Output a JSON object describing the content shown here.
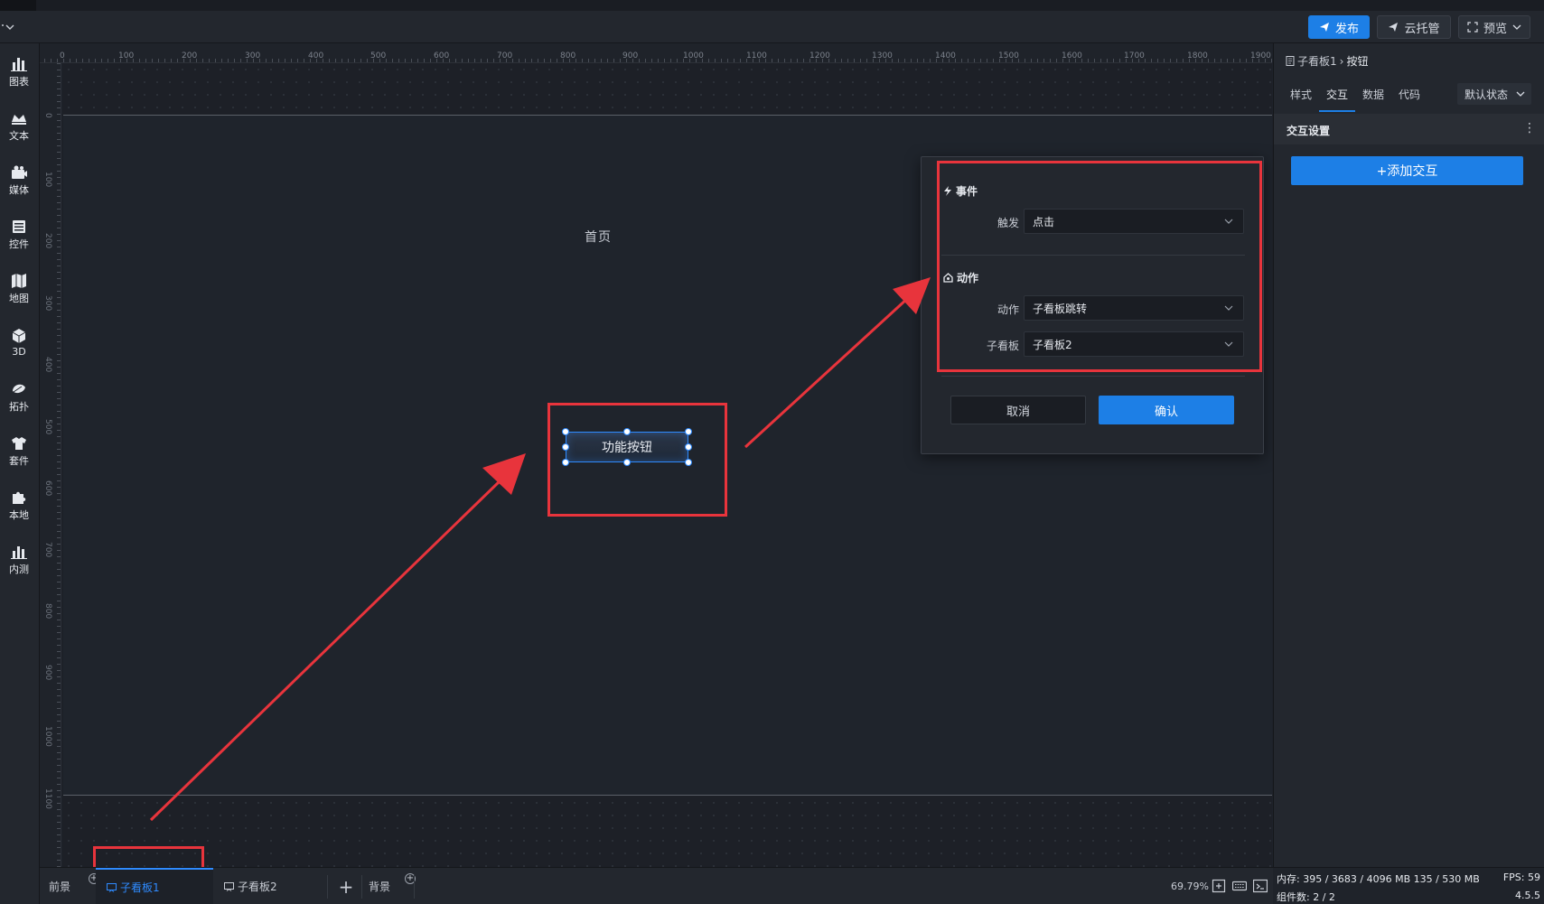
{
  "topbar": {
    "publish": "发布",
    "cloud_host": "云托管",
    "preview": "预览"
  },
  "sidebar": {
    "items": [
      {
        "label": "图表",
        "icon": "bar-chart-icon"
      },
      {
        "label": "文本",
        "icon": "text-icon"
      },
      {
        "label": "媒体",
        "icon": "camera-icon"
      },
      {
        "label": "控件",
        "icon": "widget-icon"
      },
      {
        "label": "地图",
        "icon": "map-icon"
      },
      {
        "label": "3D",
        "icon": "cube-icon"
      },
      {
        "label": "拓扑",
        "icon": "topology-icon"
      },
      {
        "label": "套件",
        "icon": "suite-icon"
      },
      {
        "label": "本地",
        "icon": "puzzle-icon"
      },
      {
        "label": "内测",
        "icon": "beta-icon"
      }
    ]
  },
  "ruler": {
    "top": [
      "0",
      "100",
      "200",
      "300",
      "400",
      "500",
      "600",
      "700",
      "800",
      "900",
      "1000",
      "1100",
      "1200",
      "1300",
      "1400",
      "1500",
      "1600",
      "1700",
      "1800",
      "1900"
    ],
    "left": [
      "0",
      "100",
      "200",
      "300",
      "400",
      "500",
      "600",
      "700",
      "800",
      "900",
      "1000",
      "1100"
    ]
  },
  "canvas": {
    "home_label": "首页",
    "function_button": "功能按钮"
  },
  "popup": {
    "event_title": "事件",
    "trigger_label": "触发",
    "trigger_value": "点击",
    "action_title": "动作",
    "action_label": "动作",
    "action_value": "子看板跳转",
    "board_label": "子看板",
    "board_value": "子看板2",
    "cancel": "取消",
    "confirm": "确认"
  },
  "right_panel": {
    "breadcrumb_parent": "子看板1",
    "breadcrumb_current": "按钮",
    "tabs": [
      "样式",
      "交互",
      "数据",
      "代码"
    ],
    "active_tab": "交互",
    "state_select": "默认状态",
    "section_title": "交互设置",
    "add_button": "+添加交互"
  },
  "bottom": {
    "tabs": [
      "前景",
      "子看板1",
      "子看板2",
      "背景"
    ],
    "add_symbol": "+",
    "zoom": "69.79%"
  },
  "status": {
    "memory": "内存: 395 / 3683 / 4096 MB  135 / 530 MB",
    "components": "组件数: 2 / 2",
    "fps": "FPS: 59",
    "version": "4.5.5"
  },
  "colors": {
    "accent": "#1d7fe6",
    "highlight": "#e8343c",
    "background": "#1e222a"
  }
}
